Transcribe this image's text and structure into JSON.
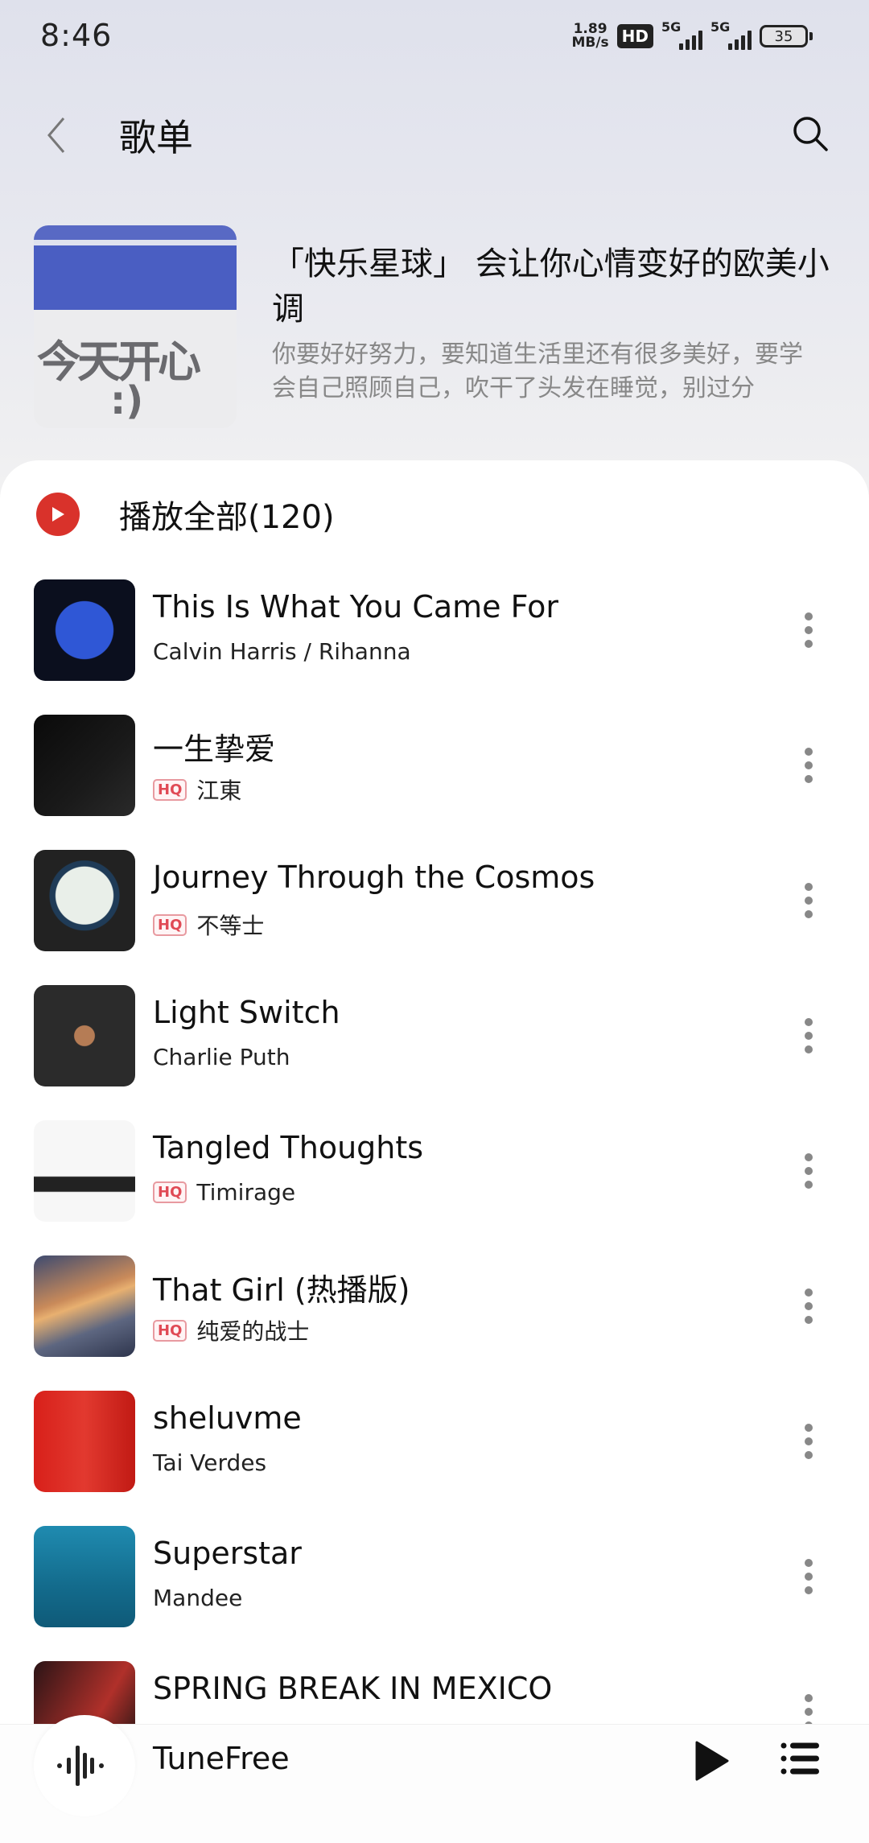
{
  "status_bar": {
    "time": "8:46",
    "net_speed_value": "1.89",
    "net_speed_unit": "MB/s",
    "hd_label": "HD",
    "sim1_label": "5G",
    "sim2_label": "5G",
    "battery": "35"
  },
  "nav": {
    "back_icon": "chevron-left-icon",
    "title": "歌单",
    "search_icon": "search-icon"
  },
  "playlist": {
    "cover_text": "今天开心",
    "cover_smile": ":)",
    "title": "「快乐星球」 会让你心情变好的欧美小调",
    "description": "你要好好努力，要知道生活里还有很多美好，要学会自己照顾自己，吹干了头发在睡觉，别过分"
  },
  "play_all": {
    "label": "播放全部(120)",
    "icon_color": "#d9322b"
  },
  "songs": [
    {
      "title": "This Is What You Came For",
      "artist": "Calvin Harris / Rihanna",
      "hq": false,
      "hq_label": ""
    },
    {
      "title": "一生挚爱",
      "artist": "江東",
      "hq": true,
      "hq_label": "HQ"
    },
    {
      "title": "Journey Through the Cosmos",
      "artist": "不等士",
      "hq": true,
      "hq_label": "HQ"
    },
    {
      "title": "Light Switch",
      "artist": "Charlie Puth",
      "hq": false,
      "hq_label": ""
    },
    {
      "title": "Tangled Thoughts",
      "artist": "Timirage",
      "hq": true,
      "hq_label": "HQ"
    },
    {
      "title": "That Girl (热播版)",
      "artist": "纯爱的战士",
      "hq": true,
      "hq_label": "HQ"
    },
    {
      "title": "sheluvme",
      "artist": "Tai Verdes",
      "hq": false,
      "hq_label": ""
    },
    {
      "title": "Superstar",
      "artist": "Mandee",
      "hq": false,
      "hq_label": ""
    },
    {
      "title": "SPRING BREAK IN MEXICO",
      "artist": "",
      "hq": false,
      "hq_label": ""
    }
  ],
  "mini_player": {
    "title": "TuneFree",
    "play_icon": "play-icon",
    "queue_icon": "playlist-icon"
  }
}
